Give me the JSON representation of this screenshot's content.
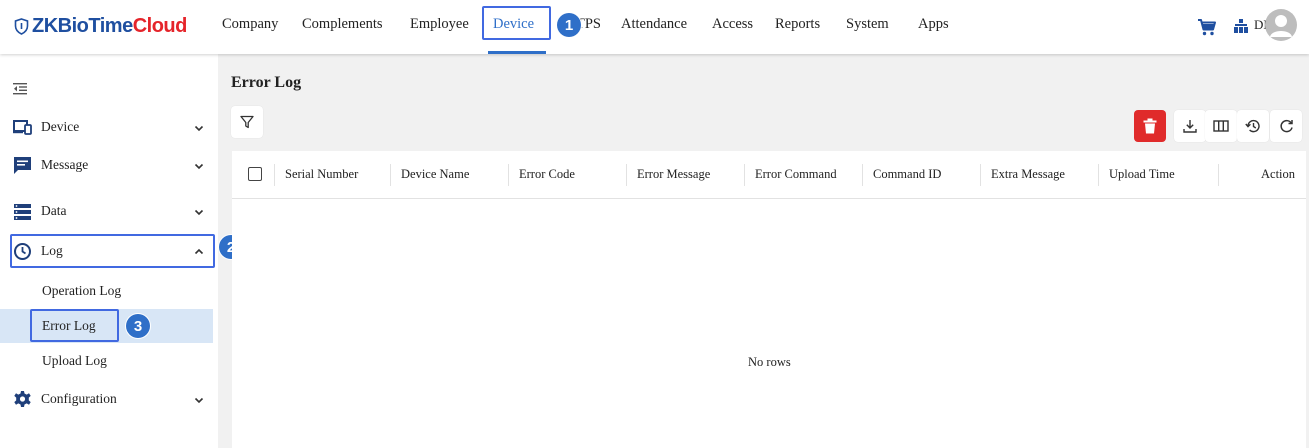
{
  "brand": {
    "part1": "ZKBioTime",
    "part2": "Cloud"
  },
  "nav": {
    "items": [
      "Company",
      "Complements",
      "Employee",
      "Device",
      "TPS",
      "Attendance",
      "Access",
      "Reports",
      "System",
      "Apps"
    ],
    "active": "Device"
  },
  "user": {
    "org_label": "DEMO"
  },
  "sidebar": {
    "items": [
      {
        "label": "Device",
        "icon": "device-icon",
        "chevron": "down"
      },
      {
        "label": "Message",
        "icon": "message-icon",
        "chevron": "down"
      },
      {
        "label": "Data",
        "icon": "data-icon",
        "chevron": "down"
      },
      {
        "label": "Log",
        "icon": "clock-icon",
        "chevron": "up"
      }
    ],
    "log_children": [
      "Operation Log",
      "Error Log",
      "Upload Log"
    ],
    "selected": "Error Log",
    "configuration": {
      "label": "Configuration",
      "icon": "gear-icon",
      "chevron": "down"
    }
  },
  "callouts": [
    "1",
    "2",
    "3"
  ],
  "page": {
    "title": "Error Log"
  },
  "table": {
    "columns": [
      "Serial Number",
      "Device Name",
      "Error Code",
      "Error Message",
      "Error Command",
      "Command ID",
      "Extra Message",
      "Upload Time",
      "Action"
    ],
    "empty_text": "No rows"
  },
  "colors": {
    "accent": "#2f6fc8",
    "delete": "#e02b2b",
    "selected_bg": "#d8e6f6",
    "callout_border": "#4169e1"
  }
}
